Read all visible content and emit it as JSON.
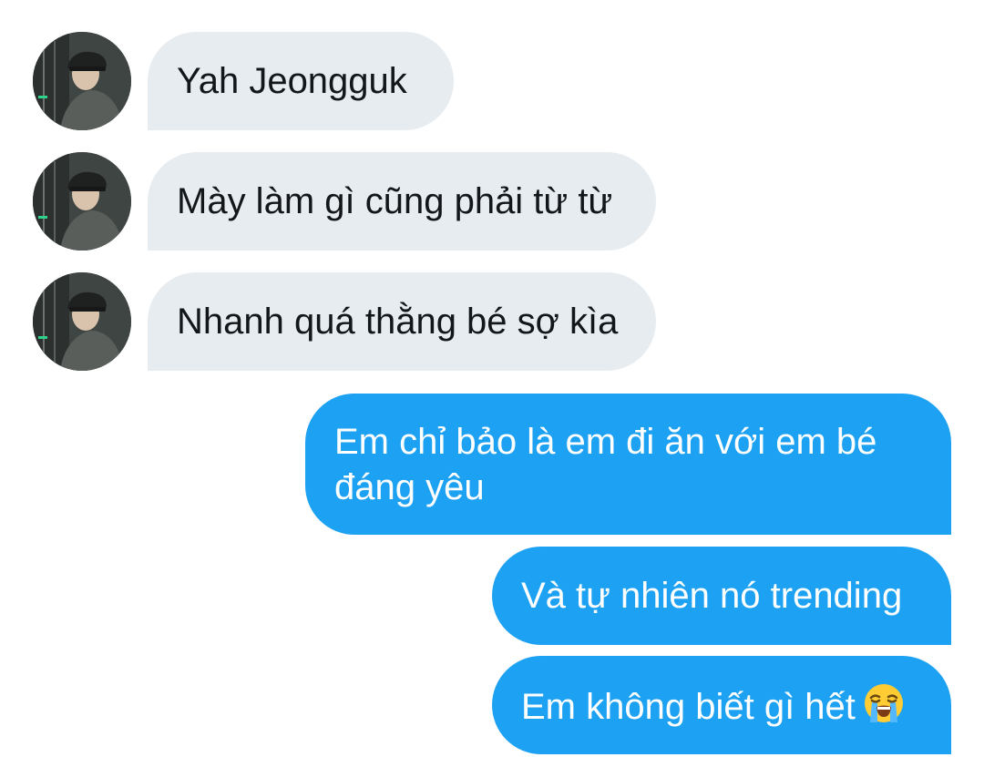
{
  "conversation": {
    "incoming": [
      {
        "text": "Yah Jeongguk"
      },
      {
        "text": "Mày làm gì cũng phải từ từ"
      },
      {
        "text": "Nhanh quá thằng bé sợ kìa"
      }
    ],
    "outgoing": [
      {
        "line1": "Em chỉ bảo là em đi ăn với em bé",
        "line2": "đáng yêu"
      },
      {
        "text": "Và tự nhiên nó trending"
      },
      {
        "text": "Em không biết gì hết",
        "emoji": "loudly-crying-face-icon"
      }
    ]
  },
  "colors": {
    "incoming_bubble": "#e6ecf0",
    "outgoing_bubble": "#1da1f2",
    "incoming_text": "#14171a",
    "outgoing_text": "#ffffff"
  }
}
